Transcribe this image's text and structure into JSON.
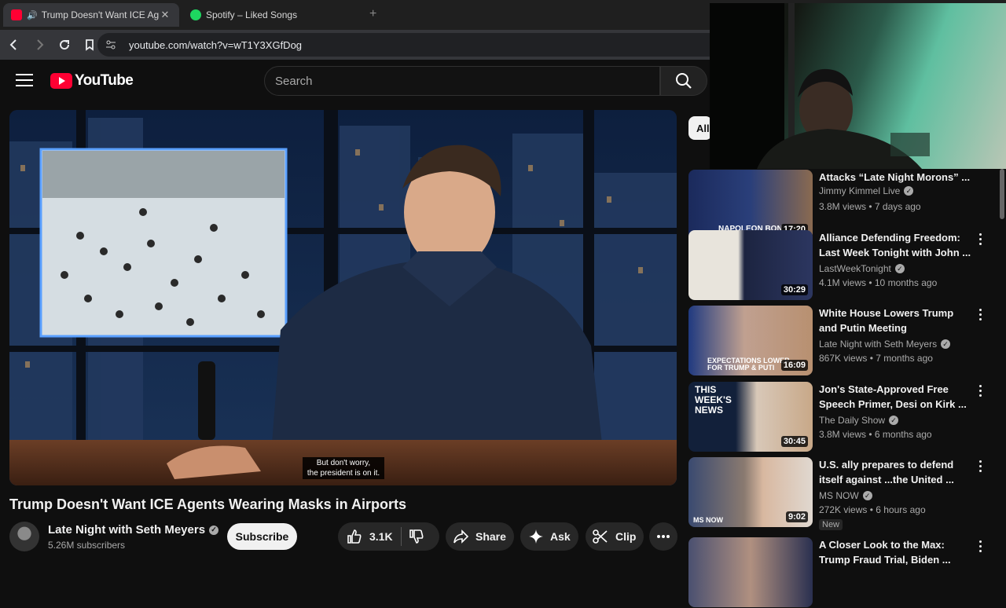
{
  "browser": {
    "tabs": [
      {
        "title": "Trump Doesn't Want ICE Agen",
        "favicon": "youtube-favicon",
        "audio_icon": "speaker-icon"
      },
      {
        "title": "Spotify – Liked Songs",
        "favicon": "spotify-favicon"
      }
    ],
    "url": "youtube.com/watch?v=wT1Y3XGfDog"
  },
  "header": {
    "logo_text": "YouTube",
    "search_placeholder": "Search"
  },
  "player": {
    "caption_line1": "But don't worry,",
    "caption_line2": "the president is on it."
  },
  "video": {
    "title": "Trump Doesn't Want ICE Agents Wearing Masks in Airports",
    "channel": "Late Night with Seth Meyers",
    "subscribers": "5.26M subscribers",
    "subscribe_label": "Subscribe",
    "likes": "3.1K",
    "share_label": "Share",
    "ask_label": "Ask",
    "clip_label": "Clip"
  },
  "chips": {
    "all_label": "All"
  },
  "recommendations": [
    {
      "title": "Attacks “Late Night Morons” ...",
      "channel": "Jimmy Kimmel Live",
      "meta": "3.8M views • 7 days ago",
      "duration": "17:20",
      "thumb_text": "NAPOLEON BON"
    },
    {
      "title": "Alliance Defending Freedom: Last Week Tonight with John ...",
      "channel": "LastWeekTonight",
      "meta": "4.1M views • 10 months ago",
      "duration": "30:29"
    },
    {
      "title": "White House Lowers Trump and Putin Meeting Expectations",
      "channel": "Late Night with Seth Meyers",
      "meta": "867K views • 7 months ago",
      "duration": "16:09",
      "thumb_text": "EXPECTATIONS LOWER FOR TRUMP & PUTI"
    },
    {
      "title": "Jon's State-Approved Free Speech Primer, Desi on Kirk ...",
      "channel": "The Daily Show",
      "meta": "3.8M views • 6 months ago",
      "duration": "30:45",
      "thumb_text": "THIS WEEK'S NEWS"
    },
    {
      "title": "U.S. ally prepares to defend itself against ...the United ...",
      "channel": "MS NOW",
      "meta": "272K views • 6 hours ago",
      "duration": "9:02",
      "badge": "New",
      "thumb_text": "MS NOW"
    },
    {
      "title": "A Closer Look to the Max: Trump Fraud Trial, Biden ...",
      "channel": "",
      "meta": "",
      "duration": ""
    }
  ],
  "colors": {
    "youtube_red": "#ff0033",
    "background": "#0f0f0f",
    "pill": "#272727"
  }
}
